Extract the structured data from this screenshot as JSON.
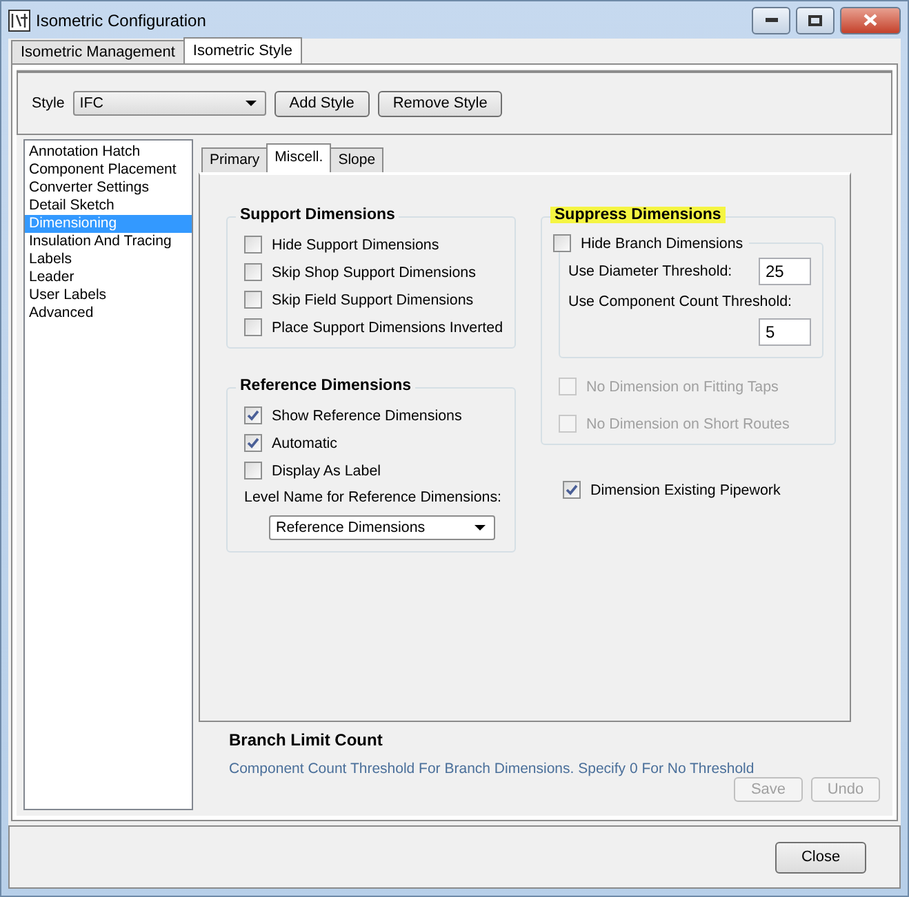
{
  "window": {
    "title": "Isometric Configuration"
  },
  "tabs": [
    {
      "label": "Isometric Management",
      "selected": false
    },
    {
      "label": "Isometric Style",
      "selected": true
    }
  ],
  "style_bar": {
    "label": "Style",
    "value": "IFC",
    "buttons": [
      "Add Style",
      "Remove Style"
    ]
  },
  "sidebar": {
    "items": [
      {
        "label": "Annotation Hatch",
        "selected": false
      },
      {
        "label": "Component Placement",
        "selected": false
      },
      {
        "label": "Converter Settings",
        "selected": false
      },
      {
        "label": "Detail Sketch",
        "selected": false
      },
      {
        "label": "Dimensioning",
        "selected": true
      },
      {
        "label": "Insulation And Tracing",
        "selected": false
      },
      {
        "label": "Labels",
        "selected": false
      },
      {
        "label": "Leader",
        "selected": false
      },
      {
        "label": "User Labels",
        "selected": false
      },
      {
        "label": "Advanced",
        "selected": false
      }
    ]
  },
  "sub_tabs": [
    {
      "label": "Primary",
      "selected": false
    },
    {
      "label": "Miscell.",
      "selected": true
    },
    {
      "label": "Slope",
      "selected": false
    }
  ],
  "support_dimensions": {
    "title": "Support Dimensions",
    "options": [
      {
        "label": "Hide Support Dimensions",
        "checked": false
      },
      {
        "label": "Skip Shop Support Dimensions",
        "checked": false
      },
      {
        "label": "Skip Field Support Dimensions",
        "checked": false
      },
      {
        "label": "Place Support Dimensions Inverted",
        "checked": false
      }
    ]
  },
  "reference_dimensions": {
    "title": "Reference Dimensions",
    "options": [
      {
        "label": "Show Reference Dimensions",
        "checked": true
      },
      {
        "label": "Automatic",
        "checked": true
      },
      {
        "label": "Display As Label",
        "checked": false
      }
    ],
    "level_label": "Level Name for Reference Dimensions:",
    "level_value": "Reference Dimensions"
  },
  "suppress_dimensions": {
    "title": "Suppress Dimensions",
    "highlighted": true,
    "hide_branch": {
      "label": "Hide Branch Dimensions",
      "checked": false
    },
    "diameter": {
      "label": "Use Diameter Threshold:",
      "value": "25"
    },
    "count": {
      "label": "Use Component Count Threshold:",
      "value": "5"
    },
    "options": [
      {
        "label": "No Dimension on Fitting Taps",
        "checked": false,
        "disabled": true
      },
      {
        "label": "No Dimension on Short Routes",
        "checked": false,
        "disabled": true
      }
    ]
  },
  "existing_pipework": {
    "label": "Dimension Existing Pipework",
    "checked": true
  },
  "branch_limit": {
    "title": "Branch Limit Count",
    "description": "Component Count Threshold For Branch Dimensions. Specify 0 For No Threshold"
  },
  "actions": [
    {
      "label": "Save",
      "disabled": true
    },
    {
      "label": "Undo",
      "disabled": true
    }
  ],
  "close": {
    "label": "Close"
  }
}
